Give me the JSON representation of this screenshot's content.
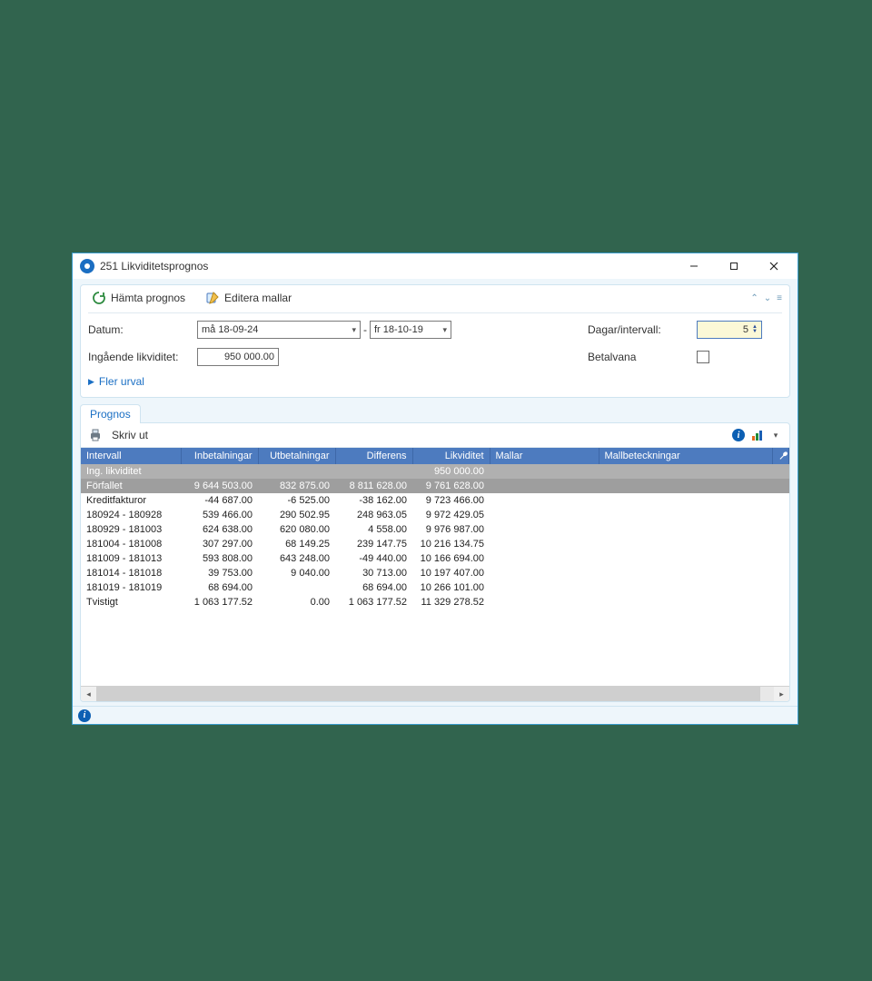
{
  "window": {
    "title": "251 Likviditetsprognos"
  },
  "toolbar": {
    "hamta_prognos": "Hämta prognos",
    "editera_mallar": "Editera mallar"
  },
  "form": {
    "datum_label": "Datum:",
    "date_from": "må 18-09-24",
    "date_to": "fr 18-10-19",
    "ing_likviditet_label": "Ingående likviditet:",
    "ing_likviditet_value": "950 000.00",
    "dagar_intervall_label": "Dagar/intervall:",
    "dagar_intervall_value": "5",
    "betalvana_label": "Betalvana",
    "betalvana_checked": false,
    "fler_urval": "Fler urval"
  },
  "tab": {
    "prognos": "Prognos"
  },
  "grid_toolbar": {
    "skriv_ut": "Skriv ut"
  },
  "columns": {
    "intervall": "Intervall",
    "inbetalningar": "Inbetalningar",
    "utbetalningar": "Utbetalningar",
    "differens": "Differens",
    "likviditet": "Likviditet",
    "mallar": "Mallar",
    "mallbeteckningar": "Mallbeteckningar"
  },
  "ing_row": {
    "label": "Ing. likviditet",
    "likviditet": "950 000.00"
  },
  "rows": [
    {
      "intervall": "Förfallet",
      "inbet": "9 644 503.00",
      "utbet": "832 875.00",
      "diff": "8 811 628.00",
      "likv": "9 761 628.00"
    },
    {
      "intervall": "Kreditfakturor",
      "inbet": "-44 687.00",
      "utbet": "-6 525.00",
      "diff": "-38 162.00",
      "likv": "9 723 466.00"
    },
    {
      "intervall": "180924 - 180928",
      "inbet": "539 466.00",
      "utbet": "290 502.95",
      "diff": "248 963.05",
      "likv": "9 972 429.05"
    },
    {
      "intervall": "180929 - 181003",
      "inbet": "624 638.00",
      "utbet": "620 080.00",
      "diff": "4 558.00",
      "likv": "9 976 987.00"
    },
    {
      "intervall": "181004 - 181008",
      "inbet": "307 297.00",
      "utbet": "68 149.25",
      "diff": "239 147.75",
      "likv": "10 216 134.75"
    },
    {
      "intervall": "181009 - 181013",
      "inbet": "593 808.00",
      "utbet": "643 248.00",
      "diff": "-49 440.00",
      "likv": "10 166 694.00"
    },
    {
      "intervall": "181014 - 181018",
      "inbet": "39 753.00",
      "utbet": "9 040.00",
      "diff": "30 713.00",
      "likv": "10 197 407.00"
    },
    {
      "intervall": "181019 - 181019",
      "inbet": "68 694.00",
      "utbet": "",
      "diff": "68 694.00",
      "likv": "10 266 101.00"
    },
    {
      "intervall": "Tvistigt",
      "inbet": "1 063 177.52",
      "utbet": "0.00",
      "diff": "1 063 177.52",
      "likv": "11 329 278.52"
    }
  ]
}
